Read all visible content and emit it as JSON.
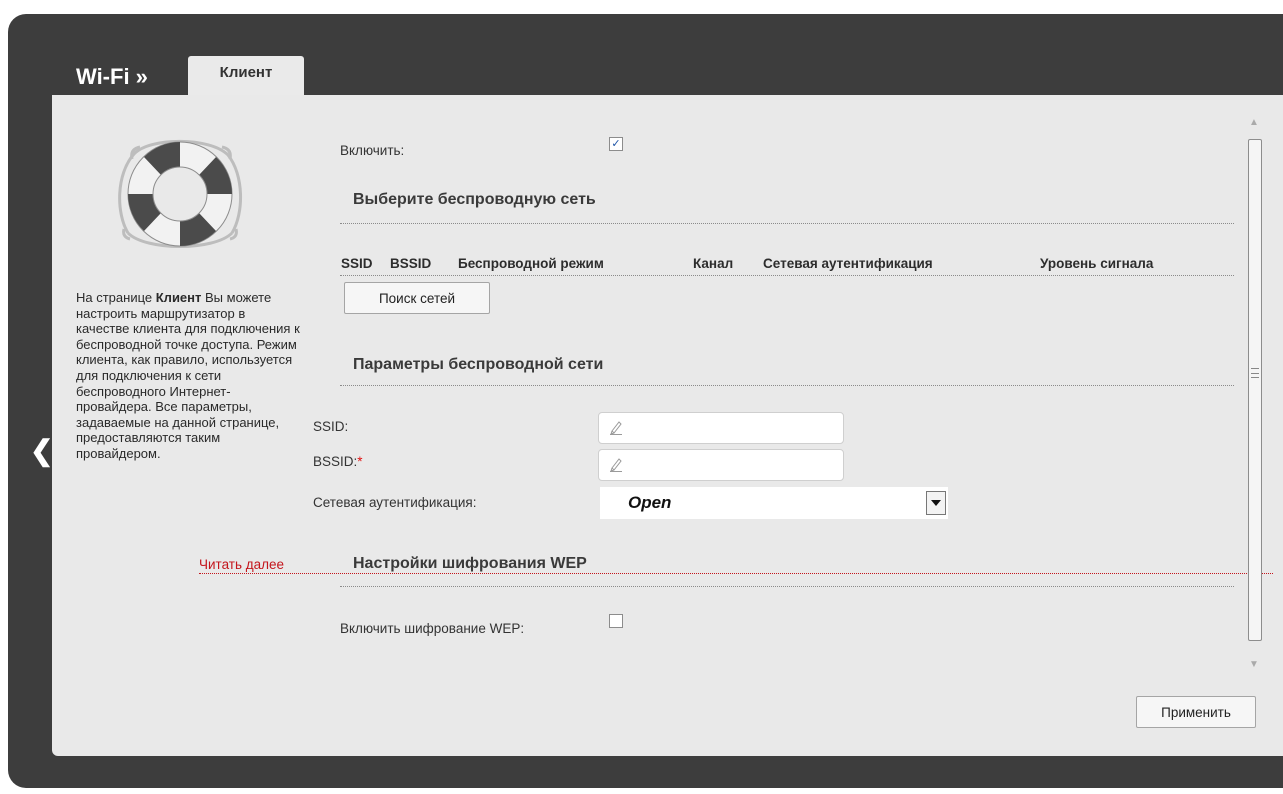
{
  "breadcrumb": {
    "root": "Wi-Fi »",
    "current_tab": "Клиент"
  },
  "sidebar": {
    "help_prefix": "На странице",
    "help_bold": "Клиент",
    "help_rest": "Вы можете настроить маршрутизатор в качестве клиента для подключения к беспроводной точке доступа. Режим клиента, как правило, используется для подключения к сети беспроводного Интернет-провайдера. Все параметры, задаваемые на данной странице, предоставляются таким провайдером.",
    "read_more": "Читать далее",
    "icon": "lifebuoy-icon"
  },
  "form": {
    "enable_label": "Включить:",
    "enable_checked": true,
    "select_network_title": "Выберите беспроводную сеть",
    "table_headers": [
      "SSID",
      "BSSID",
      "Беспроводной режим",
      "Канал",
      "Сетевая аутентификация",
      "Уровень сигнала"
    ],
    "search_button": "Поиск сетей",
    "params_title": "Параметры беспроводной сети",
    "ssid_label": "SSID:",
    "ssid_value": "",
    "bssid_label": "BSSID:",
    "bssid_required": "*",
    "bssid_value": "",
    "auth_label": "Сетевая аутентификация:",
    "auth_value": "Open",
    "wep_title": "Настройки шифрования WEP",
    "wep_enable_label": "Включить шифрование WEP:",
    "wep_checked": false,
    "apply_button": "Применить"
  },
  "colors": {
    "frame": "#3d3d3d",
    "panel": "#e9e9e9",
    "link": "#c4151c"
  }
}
